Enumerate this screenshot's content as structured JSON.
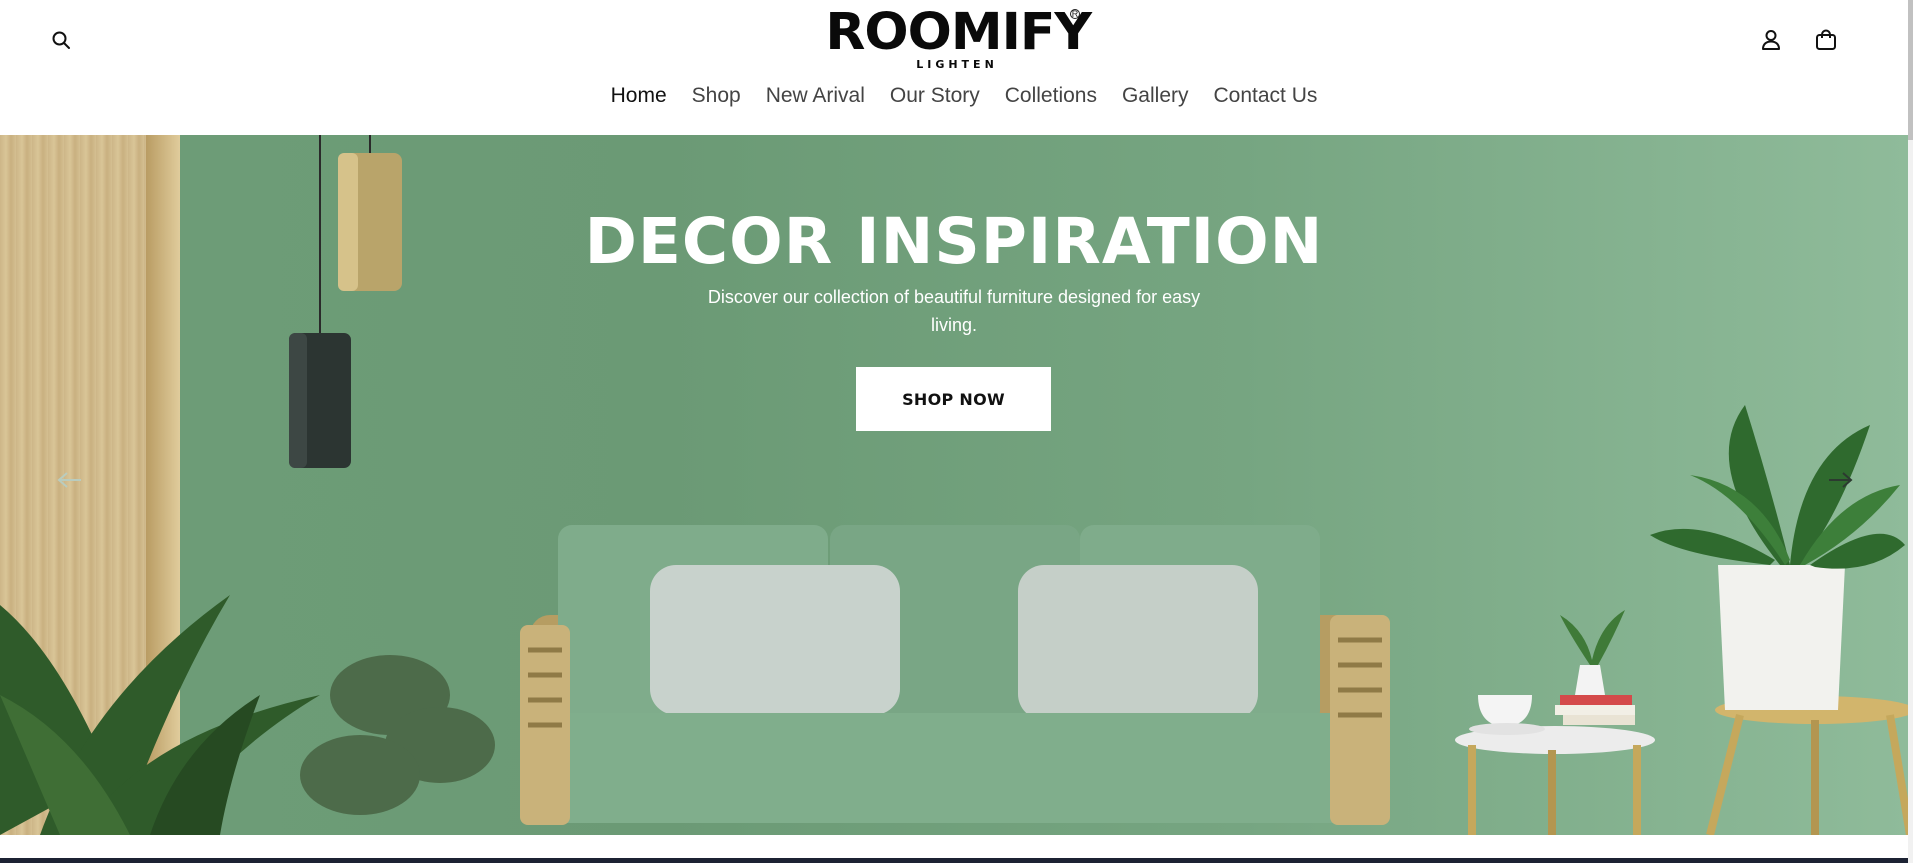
{
  "logo": {
    "name": "ROOMIFY",
    "tagline": "LIGHTEN"
  },
  "nav": {
    "items": [
      "Home",
      "Shop",
      "New Arival",
      "Our Story",
      "Colletions",
      "Gallery",
      "Contact Us"
    ],
    "active": "Home"
  },
  "hero": {
    "title": "DECOR INSPIRATION",
    "subtitle": "Discover our collection of beautiful furniture designed for easy living.",
    "cta_label": "SHOP NOW"
  },
  "icons": {
    "search": "search-icon",
    "account": "user-icon",
    "cart": "shopping-bag-icon",
    "prev": "arrow-left-icon",
    "next": "arrow-right-icon"
  },
  "colors": {
    "hero_green": "#6e9d78",
    "button_bg": "#ffffff",
    "text_dark": "#111111"
  }
}
